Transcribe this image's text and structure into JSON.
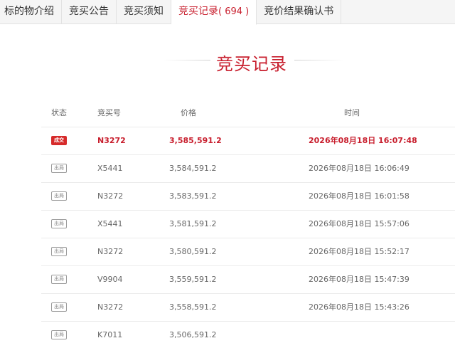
{
  "tabs": [
    {
      "label": "标的物介绍",
      "active": false
    },
    {
      "label": "竞买公告",
      "active": false
    },
    {
      "label": "竞买须知",
      "active": false
    },
    {
      "label": "竞买记录",
      "count": "( 694 )",
      "active": true
    },
    {
      "label": "竞价结果确认书",
      "active": false
    }
  ],
  "section_title": "竞买记录",
  "table": {
    "headers": {
      "status": "状态",
      "bidder": "竞买号",
      "price": "价格",
      "time": "时间"
    },
    "rows": [
      {
        "status": "成交",
        "bidder": "N3272",
        "price": "3,585,591.2",
        "time": "2026年08月18日 16:07:48"
      },
      {
        "status": "出局",
        "bidder": "X5441",
        "price": "3,584,591.2",
        "time": "2026年08月18日 16:06:49"
      },
      {
        "status": "出局",
        "bidder": "N3272",
        "price": "3,583,591.2",
        "time": "2026年08月18日 16:01:58"
      },
      {
        "status": "出局",
        "bidder": "X5441",
        "price": "3,581,591.2",
        "time": "2026年08月18日 15:57:06"
      },
      {
        "status": "出局",
        "bidder": "N3272",
        "price": "3,580,591.2",
        "time": "2026年08月18日 15:52:17"
      },
      {
        "status": "出局",
        "bidder": "V9904",
        "price": "3,559,591.2",
        "time": "2026年08月18日 15:47:39"
      },
      {
        "status": "出局",
        "bidder": "N3272",
        "price": "3,558,591.2",
        "time": "2026年08月18日 15:43:26"
      },
      {
        "status": "出局",
        "bidder": "K7011",
        "price": "3,506,591.2",
        "time": ""
      }
    ]
  },
  "colors": {
    "accent": "#c81e2d",
    "deal_badge": "#d62b2b",
    "out_badge_border": "#9a9a9a"
  }
}
